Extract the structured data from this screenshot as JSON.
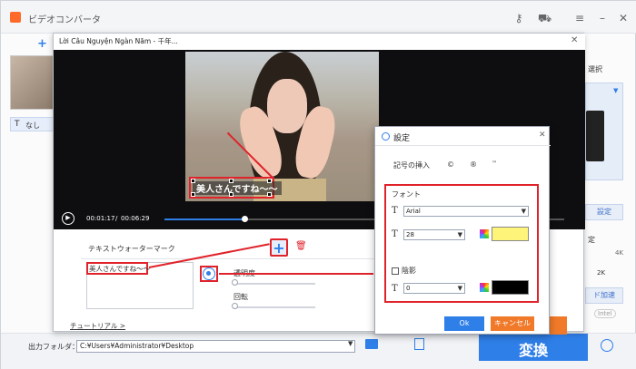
{
  "app": {
    "title": "ビデオコンバータ",
    "add_label": "+",
    "left_item_label": "なし",
    "right_panel": {
      "select_label": "選択",
      "settings_label": "設定",
      "quality_label": "定",
      "res_top": "4K",
      "res_label": "2K",
      "hw_accel": "ド加速",
      "intel": "Intel"
    },
    "bottom": {
      "output_label": "出力フォルダ：",
      "output_path": "C:¥Users¥Administrator¥Desktop",
      "convert_label": "変換"
    }
  },
  "editor": {
    "title": "Lời Câu Nguyện Ngàn Năm - 千年...",
    "subtitle_overlay": "美人さんですね～～",
    "time_current": "00:01:17",
    "time_total": "00:06:29",
    "progress": 0.2,
    "watermark_header": "テキストウォーターマーク",
    "text_value": "美人さんですね～～",
    "opacity_label": "透明度",
    "rotation_label": "回転",
    "tutorial_link": "チュートリアル >"
  },
  "dialog": {
    "title": "設定",
    "symbol_label": "記号の挿入",
    "symbol_1": "©",
    "symbol_2": "®",
    "symbol_3": "™",
    "font_section": "フォント",
    "font_name": "Arial",
    "font_size": "28",
    "font_color": "#fff47a",
    "shadow_section": "陰影",
    "shadow_value": "0",
    "shadow_color": "#000000",
    "ok_label": "Ok",
    "cancel_label": "キャンセル"
  },
  "colors": {
    "accent": "#2f7fe8",
    "highlight": "#e0232b"
  }
}
